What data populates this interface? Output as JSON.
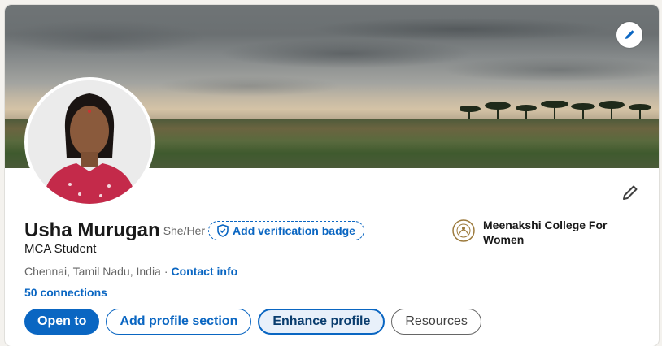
{
  "profile": {
    "name": "Usha Murugan",
    "pronouns": "She/Her",
    "verification_label": "Add verification badge",
    "headline": "MCA Student",
    "location": "Chennai, Tamil Nadu, India",
    "separator": "·",
    "contact_label": "Contact info",
    "connections": "50 connections"
  },
  "education": {
    "name": "Meenakshi College For Women"
  },
  "actions": {
    "open_to": "Open to",
    "add_section": "Add profile section",
    "enhance": "Enhance profile",
    "resources": "Resources"
  },
  "icons": {
    "cover_edit": "pencil-icon",
    "profile_edit": "pencil-icon",
    "verify": "shield-check-icon",
    "college_logo": "college-emblem-icon"
  },
  "colors": {
    "brand": "#0a66c2",
    "text": "#191919",
    "muted": "#666666"
  }
}
